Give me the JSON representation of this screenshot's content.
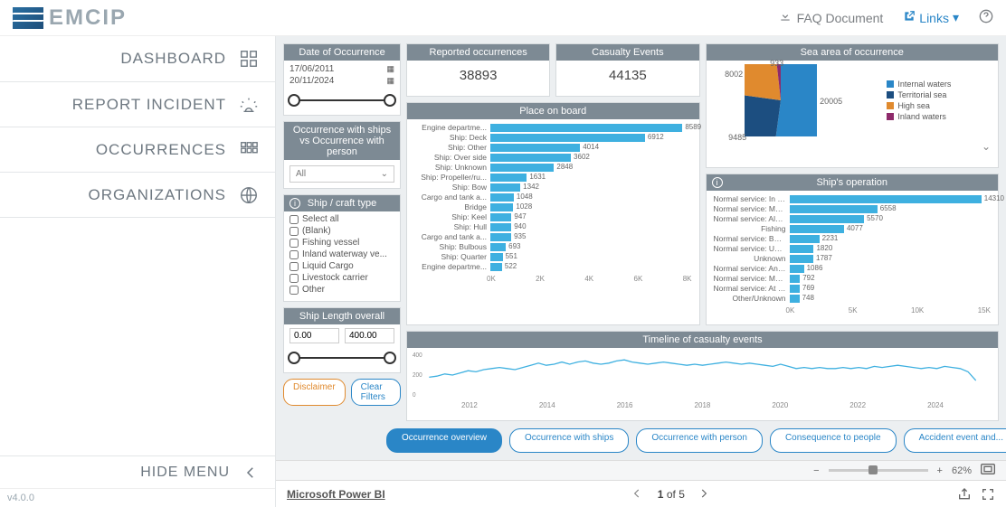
{
  "app": {
    "name": "EMCIP",
    "version": "v4.0.0"
  },
  "header": {
    "faq_label": "FAQ Document",
    "links_label": "Links"
  },
  "nav": {
    "dashboard": "DASHBOARD",
    "report": "REPORT INCIDENT",
    "occurrences": "OCCURRENCES",
    "organizations": "ORGANIZATIONS",
    "hide": "HIDE MENU"
  },
  "filters": {
    "date_title": "Date of Occurrence",
    "date_from": "17/06/2011",
    "date_to": "20/11/2024",
    "occ_vs_title": "Occurrence with ships vs Occurrence with person",
    "occ_vs_selected": "All",
    "ship_type_title": "Ship / craft type",
    "ship_types": [
      "Select all",
      "(Blank)",
      "Fishing vessel",
      "Inland waterway ve...",
      "Liquid Cargo",
      "Livestock carrier",
      "Other"
    ],
    "len_title": "Ship Length overall",
    "len_min": "0.00",
    "len_max": "400.00",
    "disclaimer_label": "Disclaimer",
    "clear_label": "Clear Filters"
  },
  "metrics": {
    "reported_title": "Reported occurrences",
    "reported_value": "38893",
    "casualty_title": "Casualty Events",
    "casualty_value": "44135"
  },
  "chart_data": {
    "place_on_board": {
      "type": "bar",
      "title": "Place on board",
      "categories": [
        "Engine departme...",
        "Ship: Deck",
        "Ship: Other",
        "Ship: Over side",
        "Ship: Unknown",
        "Ship: Propeller/ru...",
        "Ship: Bow",
        "Cargo and tank a...",
        "Bridge",
        "Ship: Keel",
        "Ship: Hull",
        "Cargo and tank a...",
        "Ship: Bulbous",
        "Ship: Quarter",
        "Engine departme..."
      ],
      "values": [
        8589,
        6912,
        4014,
        3602,
        2848,
        1631,
        1342,
        1048,
        1028,
        947,
        940,
        935,
        693,
        551,
        522
      ],
      "x_ticks": [
        "0K",
        "2K",
        "4K",
        "6K",
        "8K"
      ],
      "xlim": [
        0,
        9000
      ]
    },
    "ships_operation": {
      "type": "bar",
      "title": "Ship's operation",
      "categories": [
        "Normal service: In p...",
        "Normal service: Man...",
        "Normal service: Alon...",
        "Fishing",
        "Normal service: Bert...",
        "Normal service: Und...",
        "Unknown",
        "Normal service: Anc...",
        "Normal service: Moo...",
        "Normal service: At a...",
        "Other/Unknown"
      ],
      "values": [
        14310,
        6558,
        5570,
        4077,
        2231,
        1820,
        1787,
        1086,
        792,
        769,
        748
      ],
      "x_ticks": [
        "0K",
        "5K",
        "10K",
        "15K"
      ],
      "xlim": [
        0,
        15000
      ]
    },
    "sea_area": {
      "type": "pie",
      "title": "Sea area of occurrence",
      "series": [
        {
          "name": "Internal waters",
          "value": 20005,
          "color": "#2a86c7"
        },
        {
          "name": "Territorial sea",
          "value": 9485,
          "color": "#1c4e80"
        },
        {
          "name": "High sea",
          "value": 8002,
          "color": "#e08a2e"
        },
        {
          "name": "Inland waters",
          "value": 933,
          "color": "#8e2a6b"
        }
      ]
    },
    "timeline": {
      "type": "line",
      "title": "Timeline of casualty events",
      "x_ticks": [
        "2012",
        "2014",
        "2016",
        "2018",
        "2020",
        "2022",
        "2024"
      ],
      "y_ticks": [
        "0",
        "200",
        "400"
      ],
      "ylim": [
        0,
        400
      ],
      "approx_monthly_values": [
        180,
        190,
        210,
        200,
        220,
        240,
        230,
        250,
        260,
        270,
        260,
        250,
        270,
        290,
        310,
        290,
        300,
        320,
        300,
        320,
        330,
        310,
        300,
        310,
        330,
        340,
        320,
        310,
        300,
        310,
        320,
        310,
        300,
        290,
        300,
        290,
        300,
        310,
        320,
        310,
        300,
        310,
        300,
        290,
        280,
        300,
        280,
        260,
        270,
        260,
        270,
        260,
        260,
        270,
        260,
        270,
        260,
        280,
        270,
        280,
        290,
        280,
        270,
        260,
        270,
        260,
        280,
        270,
        260,
        230,
        150
      ]
    }
  },
  "page_tabs": {
    "items": [
      "Occurrence overview",
      "Occurrence with ships",
      "Occurrence with person",
      "Consequence to people",
      "Accident event and..."
    ],
    "active": 0
  },
  "footer": {
    "brand": "Microsoft Power BI",
    "page_current": "1",
    "page_of": "of",
    "page_total": "5",
    "zoom": "62%"
  }
}
